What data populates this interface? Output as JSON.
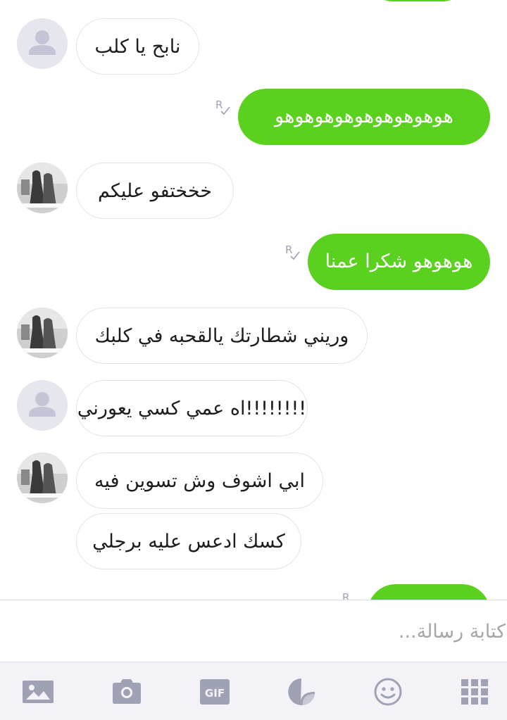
{
  "conversation": {
    "messages": [
      {
        "from": "them",
        "avatar": "default-avatar",
        "text": "نابح يا كلب"
      },
      {
        "from": "me",
        "read_mark": "R",
        "text": "هوهوهوهوهوهوهوهوهو"
      },
      {
        "from": "them",
        "avatar": "photo-avatar",
        "text": "خخختفو عليكم"
      },
      {
        "from": "me",
        "read_mark": "R",
        "text": "هوهوهو شكرا عمنا"
      },
      {
        "from": "them",
        "avatar": "photo-avatar",
        "text": "وريني شطارتك يالقحبه في كلبك"
      },
      {
        "from": "them",
        "avatar": "default-avatar",
        "text": "!!!!!!!!اه عمي كسي يعورني"
      },
      {
        "from": "them",
        "avatar": "photo-avatar",
        "text": "ابي اشوف وش تسوين فيه"
      },
      {
        "from": "them",
        "avatar": "none",
        "text": "كسك ادعس عليه برجلي"
      }
    ]
  },
  "composer": {
    "placeholder": "كتابة رسالة..."
  },
  "toolbar": {
    "gif_label": "GIF",
    "items": [
      "gallery-icon",
      "camera-icon",
      "gif-icon",
      "sticker-icon",
      "emoji-icon",
      "more-grid-icon"
    ]
  },
  "colors": {
    "outgoing_bubble": "#5ad11f",
    "incoming_border": "#e3e3e9",
    "icon_gray": "#9fa1b5"
  }
}
